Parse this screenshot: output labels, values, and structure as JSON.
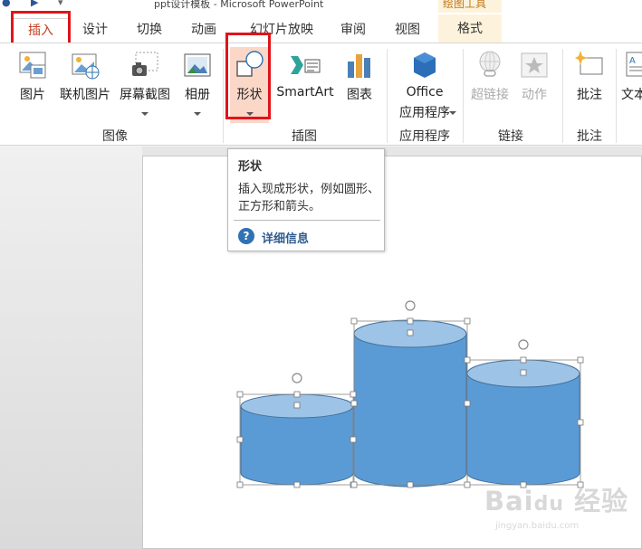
{
  "window": {
    "title": "ppt设计模板 - Microsoft PowerPoint"
  },
  "contextual_tab_group": {
    "label": "绘图工具"
  },
  "tabs": [
    {
      "label": "插入",
      "active": true
    },
    {
      "label": "设计"
    },
    {
      "label": "切换"
    },
    {
      "label": "动画"
    },
    {
      "label": "幻灯片放映"
    },
    {
      "label": "审阅"
    },
    {
      "label": "视图"
    },
    {
      "label": "格式"
    }
  ],
  "ribbon": {
    "images": {
      "picture": "图片",
      "online_picture": "联机图片",
      "screenshot": "屏幕截图",
      "album": "相册",
      "group_label": "图像"
    },
    "illustrations": {
      "shapes": "形状",
      "smartart": "SmartArt",
      "chart": "图表",
      "group_label": "插图"
    },
    "apps": {
      "office_line1": "Office",
      "office_line2": "应用程序",
      "group_label": "应用程序"
    },
    "links": {
      "hyperlink": "超链接",
      "action": "动作",
      "group_label": "链接"
    },
    "comments": {
      "comment": "批注",
      "group_label": "批注"
    },
    "text": {
      "textbox": "文本"
    }
  },
  "tooltip": {
    "title": "形状",
    "description": "插入现成形状，例如圆形、正方形和箭头。",
    "more_info": "详细信息"
  },
  "colors": {
    "accent_red": "#e0141b",
    "cylinder_body": "#5b9bd5",
    "cylinder_top": "#9dc3e6",
    "cylinder_stroke": "#41719c"
  },
  "watermark": {
    "logo": "Bai du 经验",
    "url": "jingyan.baidu.com"
  }
}
